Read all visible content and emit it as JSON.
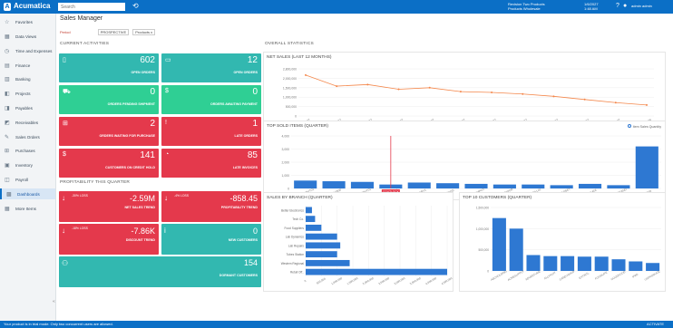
{
  "header": {
    "logo_text": "Acumatica",
    "search_placeholder": "Search",
    "history_icon": "history-icon",
    "company_line1": "Revision Two Products",
    "company_line2": "Products Wholesale",
    "date_line1": "1/6/2027",
    "date_line2": "1:48 AM",
    "user_name": "admin admin"
  },
  "sidebar": {
    "items": [
      {
        "label": "Favorites",
        "icon": "star-icon"
      },
      {
        "label": "Data Views",
        "icon": "grid-icon"
      },
      {
        "label": "Time and Expenses",
        "icon": "clock-icon"
      },
      {
        "label": "Finance",
        "icon": "finance-icon"
      },
      {
        "label": "Banking",
        "icon": "bank-icon"
      },
      {
        "label": "Projects",
        "icon": "projects-icon"
      },
      {
        "label": "Payables",
        "icon": "payables-icon"
      },
      {
        "label": "Receivables",
        "icon": "receivables-icon"
      },
      {
        "label": "Sales Orders",
        "icon": "sales-icon"
      },
      {
        "label": "Purchases",
        "icon": "cart-icon"
      },
      {
        "label": "Inventory",
        "icon": "box-icon"
      },
      {
        "label": "Payroll",
        "icon": "payroll-icon"
      },
      {
        "label": "Dashboards",
        "icon": "dashboard-icon"
      },
      {
        "label": "More Items",
        "icon": "more-icon"
      }
    ],
    "active_index": 12
  },
  "page": {
    "title": "Sales Manager",
    "filter_label": "Period",
    "filter_chip1": "PROSPECTIVE",
    "filter_chip2": "Products x"
  },
  "sections": {
    "current_activities": "CURRENT ACTIVITIES",
    "profitability": "PROFITABILITY THIS QUARTER",
    "overall_stats": "OVERALL STATISTICS"
  },
  "tiles": [
    {
      "value": "602",
      "label": "OPEN ORDERS",
      "color": "teal",
      "icon": "document-icon"
    },
    {
      "value": "12",
      "label": "OPEN ORDERS",
      "color": "teal",
      "icon": "folder-icon"
    },
    {
      "value": "0",
      "label": "ORDERS PENDING SHIPMENT",
      "color": "green",
      "icon": "truck-icon"
    },
    {
      "value": "0",
      "label": "ORDERS AWAITING PAYMENT",
      "color": "green",
      "icon": "pay-icon"
    },
    {
      "value": "2",
      "label": "ORDERS WAITING FOR PURCHASE",
      "color": "red",
      "icon": "cart-icon"
    },
    {
      "value": "1",
      "label": "LATE ORDERS",
      "color": "red",
      "icon": "alert-icon"
    },
    {
      "value": "141",
      "label": "CUSTOMERS ON CREDIT HOLD",
      "color": "red",
      "icon": "dollar-icon"
    },
    {
      "value": "85",
      "label": "LATE INVOICES",
      "color": "red",
      "icon": "timer-icon"
    }
  ],
  "profit_tiles": [
    {
      "value": "-2.59M",
      "label": "NET SALES TREND",
      "pct": "-30%\nLOSS"
    },
    {
      "value": "-858.45",
      "label": "PROFITABILITY TREND",
      "pct": "-4%\nLOSS"
    },
    {
      "value": "-7.86K",
      "label": "DISCOUNT TREND",
      "pct": "-18%\nLOSS"
    },
    {
      "value": "0",
      "label": "NEW CUSTOMERS",
      "pct": ""
    },
    {
      "value": "154",
      "label": "DORMANT CUSTOMERS",
      "pct": ""
    }
  ],
  "chart_data": [
    {
      "type": "line",
      "title": "NET SALES (LAST 12 MONTHS)",
      "x": [
        "02/2027",
        "03/2027",
        "04/2027",
        "05/2027",
        "06/2027",
        "07/2027",
        "08/2027",
        "09/2027",
        "10/2027",
        "11/2027",
        "12/2027",
        "01/2028"
      ],
      "values": [
        2600000,
        1900000,
        2000000,
        1700000,
        1800000,
        1550000,
        1500000,
        1400000,
        1250000,
        1050000,
        850000,
        700000
      ],
      "yticks": [
        "2,800,000",
        "2,000,000",
        "1,500,000",
        "1,000,000",
        "500,000",
        "0"
      ],
      "ylim": [
        0,
        3000000
      ],
      "color": "#f4874b"
    },
    {
      "type": "bar",
      "title": "TOP SOLD ITEMS (QUARTER)",
      "legend_label": "Item Sales Quantity",
      "categories": [
        "AACOMPUT01",
        "AALEGO500",
        "ACCOMPUT01",
        "COUTLOCK",
        "CONBABY1",
        "CONBAGS",
        "CONCOMPUT",
        "CONFRDOOR",
        "CONGRILL01",
        "CONHEADSET",
        "CONSKATE",
        "CPUWSTAND",
        "JUICER"
      ],
      "values": [
        600,
        550,
        500,
        300,
        450,
        400,
        350,
        300,
        300,
        250,
        350,
        250,
        3200
      ],
      "highlight_index": 3,
      "highlight_label": "COUTLOCK",
      "yticks": [
        "4,000",
        "3,000",
        "2,000",
        "1,000",
        "0"
      ],
      "ylim": [
        0,
        4000
      ],
      "color": "#2e78d2"
    },
    {
      "type": "bar",
      "title": "SALES BY BRANCH (QUARTER)",
      "orientation": "horizontal",
      "categories": [
        "Better Electronics",
        "Tech Co.",
        "Food Suppliers",
        "Lab Dynamics",
        "Lab Repairs",
        "Tubes Station",
        "Western Regional",
        "Retail Off.."
      ],
      "values": [
        0.2,
        0.3,
        0.5,
        1.0,
        1.1,
        1.0,
        1.4,
        4.5
      ],
      "xticks": [
        "0",
        "500,000",
        "1,000,000",
        "1,500,000",
        "2,000,000",
        "2,500,000",
        "3,000,000",
        "3,500,000",
        "4,000,000",
        "4,500,000"
      ],
      "color": "#2e78d2"
    },
    {
      "type": "bar",
      "title": "TOP 10 CUSTOMERS (QUARTER)",
      "categories": [
        "ABCHOLDING",
        "ACMESUPPLY",
        "ADVENTURE",
        "ALLFRUIT",
        "CANDYSHOP",
        "EXTINTL",
        "FOODLIFE",
        "GOODFOOD",
        "IPAD",
        "USPRODUCE"
      ],
      "values": [
        1.0,
        0.8,
        0.3,
        0.28,
        0.28,
        0.27,
        0.27,
        0.22,
        0.18,
        0.15
      ],
      "yticks": [
        "1,500,000",
        "1,000,000",
        "500,000",
        "0"
      ],
      "ylim": [
        0,
        1.2
      ],
      "color": "#2e78d2"
    }
  ],
  "statusbar": {
    "left": "Your product is in trial mode. Only two concurrent users are allowed.",
    "right": "ACTIVATE"
  }
}
